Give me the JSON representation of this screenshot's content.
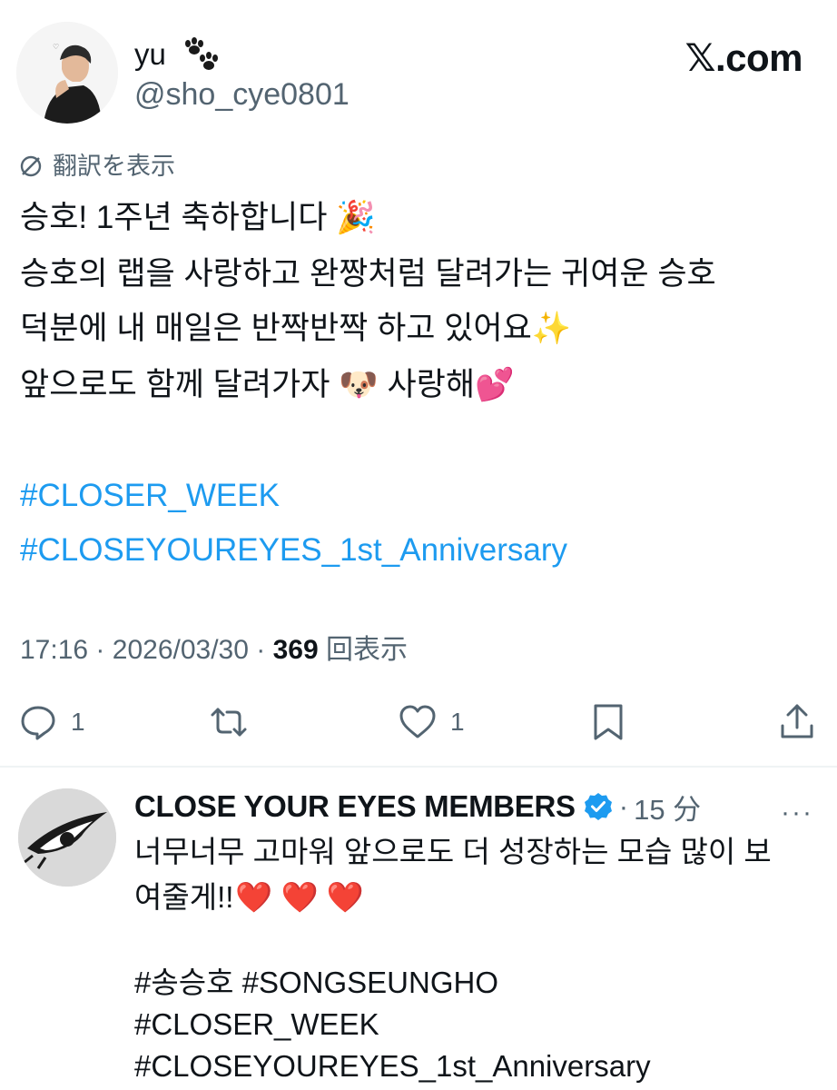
{
  "tweet": {
    "display_name": "yu",
    "username": "@sho_cye0801",
    "brand": "𝕏.com",
    "translate_label": "翻訳を表示",
    "lines": [
      "승호! 1주년 축하합니다 🎉",
      "승호의 랩을 사랑하고 완짱처럼 달려가는 귀여운 승호",
      "덕분에 내 매일은 반짝반짝 하고 있어요✨",
      "앞으로도 함께 달려가자 🐶 사랑해💕"
    ],
    "hashtags": [
      "#CLOSER_WEEK",
      "#CLOSEYOUREYES_1st_Anniversary"
    ],
    "time": "17:16",
    "separator": "·",
    "date": "2026/03/30",
    "view_count": "369",
    "view_label": "回表示"
  },
  "actions": {
    "reply_count": "1",
    "like_count": "1"
  },
  "reply": {
    "display_name": "CLOSE YOUR EYES MEMBERS",
    "separator": "·",
    "time": "15 分",
    "more": "···",
    "lines": [
      "너무너무 고마워 앞으로도 더 성장하는 모습 많이 보",
      "여줄게!!"
    ],
    "hearts": "❤️ ❤️ ❤️",
    "hashtag_line_1": [
      "#송승호",
      "#SONGSEUNGHO"
    ],
    "hashtag_line_2": "#CLOSER_WEEK",
    "hashtag_line_3": "#CLOSEYOUREYES_1st_Anniversary"
  },
  "colors": {
    "link": "#1d9bf0",
    "secondary_text": "#536471",
    "verified": "#1d9bf0",
    "heart": "#e0245e"
  }
}
